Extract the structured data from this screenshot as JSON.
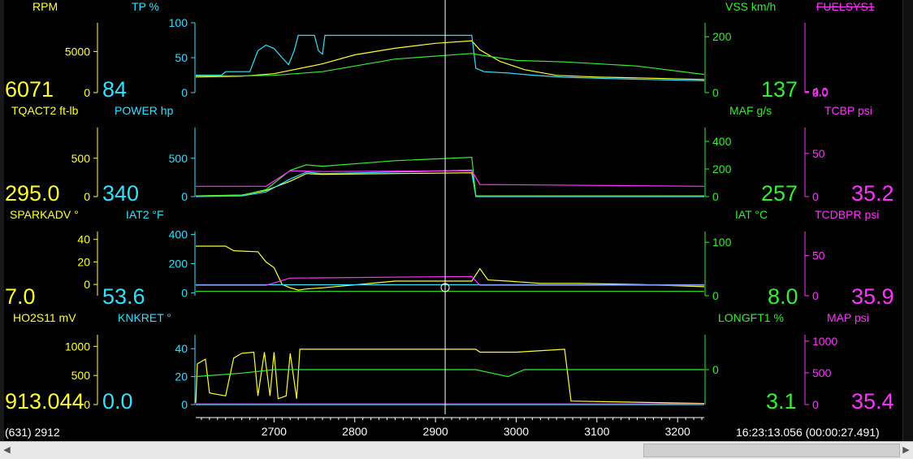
{
  "colors": {
    "yellow": "#ffff33",
    "cyan": "#33e0ff",
    "green": "#33ee33",
    "magenta": "#ff33ff",
    "white": "#ffffff",
    "pink": "#ff6699",
    "blue": "#6688ff"
  },
  "panels": [
    {
      "left_label": "RPM",
      "left_value": "6071",
      "left_ticks": [
        "5000",
        "0"
      ],
      "mid_label": "TP %",
      "mid_value": "84",
      "mid_ticks": [
        "100",
        "50",
        "0"
      ],
      "right_label": "VSS km/h",
      "right_value": "137",
      "right_ticks": [
        "200",
        "0"
      ],
      "far_label": "FUELSYS1",
      "far_ticks": [
        "4.0",
        "2.0",
        "0.0"
      ]
    },
    {
      "left_label": "TQACT2 ft-lb",
      "left_value": "295.0",
      "left_ticks": [
        "500",
        "0"
      ],
      "mid_label": "POWER hp",
      "mid_value": "340",
      "mid_ticks": [
        "500",
        "0"
      ],
      "right_label": "MAF g/s",
      "right_value": "257",
      "right_ticks": [
        "400",
        "200",
        "0"
      ],
      "far_label": "TCBP psi",
      "far_value": "35.2",
      "far_ticks": [
        "50",
        "0"
      ]
    },
    {
      "left_label": "SPARKADV °",
      "left_value": "7.0",
      "left_ticks": [
        "40",
        "20",
        "0"
      ],
      "mid_label": "IAT2 °F",
      "mid_value": "53.6",
      "mid_ticks": [
        "400",
        "200",
        "0"
      ],
      "right_label": "IAT °C",
      "right_value": "8.0",
      "right_ticks": [
        "100",
        "0"
      ],
      "far_label": "TCDBPR psi",
      "far_value": "35.9",
      "far_ticks": [
        "50",
        "0"
      ]
    },
    {
      "left_label": "HO2S11 mV",
      "left_value": "913.044",
      "left_ticks": [
        "1000",
        "500",
        "0"
      ],
      "mid_label": "KNKRET °",
      "mid_value": "0.0",
      "mid_ticks": [
        "40",
        "20",
        "0"
      ],
      "right_label": "LONGFT1 %",
      "right_value": "3.1",
      "right_ticks": [
        "0"
      ],
      "far_label": "MAP psi",
      "far_value": "35.4",
      "far_ticks": [
        "1000",
        "500",
        "0"
      ]
    }
  ],
  "status": {
    "left": "(631) 2912",
    "right": "16:23:13.056 (00:00:27.491)"
  },
  "chart_data": {
    "type": "line",
    "x_ticks": [
      "2700",
      "2800",
      "2900",
      "3000",
      "3100",
      "3200"
    ],
    "xlim": [
      2603,
      3233
    ],
    "cursor_x": 2912,
    "panels": [
      {
        "series": [
          {
            "name": "RPM",
            "color": "yellow",
            "ylim": [
              0,
              8500
            ],
            "points": [
              [
                2603,
                1900
              ],
              [
                2660,
                2000
              ],
              [
                2700,
                2300
              ],
              [
                2760,
                3500
              ],
              [
                2800,
                4600
              ],
              [
                2850,
                5400
              ],
              [
                2900,
                6000
              ],
              [
                2945,
                6300
              ],
              [
                2955,
                5200
              ],
              [
                2980,
                3800
              ],
              [
                3010,
                2800
              ],
              [
                3050,
                2100
              ],
              [
                3100,
                1900
              ],
              [
                3150,
                1800
              ],
              [
                3233,
                1600
              ]
            ]
          },
          {
            "name": "TP %",
            "color": "cyan",
            "ylim": [
              0,
              100
            ],
            "points": [
              [
                2603,
                25
              ],
              [
                2635,
                25
              ],
              [
                2640,
                30
              ],
              [
                2670,
                30
              ],
              [
                2680,
                60
              ],
              [
                2690,
                68
              ],
              [
                2700,
                63
              ],
              [
                2710,
                50
              ],
              [
                2718,
                40
              ],
              [
                2725,
                60
              ],
              [
                2730,
                82
              ],
              [
                2750,
                82
              ],
              [
                2755,
                60
              ],
              [
                2760,
                55
              ],
              [
                2763,
                82
              ],
              [
                2945,
                82
              ],
              [
                2950,
                35
              ],
              [
                2960,
                30
              ],
              [
                2990,
                28
              ],
              [
                3020,
                25
              ],
              [
                3060,
                22
              ],
              [
                3120,
                20
              ],
              [
                3233,
                17
              ]
            ]
          },
          {
            "name": "VSS km/h",
            "color": "green",
            "ylim": [
              0,
              250
            ],
            "points": [
              [
                2603,
                60
              ],
              [
                2660,
                60
              ],
              [
                2700,
                62
              ],
              [
                2760,
                75
              ],
              [
                2850,
                120
              ],
              [
                2945,
                140
              ],
              [
                2955,
                135
              ],
              [
                3000,
                115
              ],
              [
                3060,
                110
              ],
              [
                3150,
                95
              ],
              [
                3233,
                65
              ]
            ]
          }
        ]
      },
      {
        "series": [
          {
            "name": "TQACT2 ft-lb",
            "color": "yellow",
            "ylim": [
              0,
              900
            ],
            "points": [
              [
                2603,
                10
              ],
              [
                2660,
                20
              ],
              [
                2690,
                80
              ],
              [
                2720,
                200
              ],
              [
                2740,
                300
              ],
              [
                2760,
                290
              ],
              [
                2850,
                300
              ],
              [
                2945,
                310
              ],
              [
                2950,
                10
              ],
              [
                3233,
                10
              ]
            ]
          },
          {
            "name": "POWER hp",
            "color": "cyan",
            "ylim": [
              0,
              900
            ],
            "points": [
              [
                2603,
                0
              ],
              [
                2660,
                10
              ],
              [
                2690,
                60
              ],
              [
                2720,
                230
              ],
              [
                2740,
                320
              ],
              [
                2760,
                300
              ],
              [
                2850,
                320
              ],
              [
                2945,
                345
              ],
              [
                2950,
                0
              ],
              [
                3233,
                0
              ]
            ]
          },
          {
            "name": "MAF g/s",
            "color": "green",
            "ylim": [
              0,
              500
            ],
            "points": [
              [
                2603,
                5
              ],
              [
                2660,
                10
              ],
              [
                2690,
                50
              ],
              [
                2720,
                190
              ],
              [
                2740,
                230
              ],
              [
                2760,
                220
              ],
              [
                2850,
                260
              ],
              [
                2945,
                285
              ],
              [
                2950,
                5
              ],
              [
                3233,
                5
              ]
            ]
          },
          {
            "name": "TCBP psi",
            "color": "magenta",
            "ylim": [
              0,
              80
            ],
            "points": [
              [
                2603,
                12
              ],
              [
                2690,
                12
              ],
              [
                2720,
                30
              ],
              [
                2760,
                29
              ],
              [
                2945,
                30
              ],
              [
                2955,
                14
              ],
              [
                3233,
                12
              ]
            ]
          }
        ]
      },
      {
        "series": [
          {
            "name": "SPARKADV °",
            "color": "yellow",
            "ylim": [
              -10,
              47
            ],
            "points": [
              [
                2603,
                34
              ],
              [
                2640,
                34
              ],
              [
                2650,
                30
              ],
              [
                2680,
                29
              ],
              [
                2690,
                20
              ],
              [
                2700,
                15
              ],
              [
                2710,
                0
              ],
              [
                2720,
                -3
              ],
              [
                2730,
                -5
              ],
              [
                2740,
                -4
              ],
              [
                2760,
                -3
              ],
              [
                2850,
                3
              ],
              [
                2945,
                3
              ],
              [
                2955,
                14
              ],
              [
                2965,
                4
              ],
              [
                2990,
                3
              ],
              [
                3030,
                1
              ],
              [
                3080,
                1
              ],
              [
                3150,
                0
              ],
              [
                3233,
                -2
              ]
            ]
          },
          {
            "name": "IAT2 °F",
            "color": "cyan",
            "ylim": [
              -20,
              420
            ],
            "points": [
              [
                2603,
                55
              ],
              [
                3233,
                55
              ]
            ]
          },
          {
            "name": "IAT °C",
            "color": "green",
            "ylim": [
              0,
              120
            ],
            "points": [
              [
                2603,
                8
              ],
              [
                3233,
                8
              ]
            ]
          },
          {
            "name": "TCDBPR psi",
            "color": "magenta",
            "ylim": [
              0,
              80
            ],
            "points": [
              [
                2603,
                13
              ],
              [
                2690,
                13
              ],
              [
                2720,
                22
              ],
              [
                2945,
                24
              ],
              [
                2955,
                13
              ],
              [
                3233,
                13
              ]
            ]
          }
        ]
      },
      {
        "series": [
          {
            "name": "HO2S11 mV",
            "color": "yellow",
            "ylim": [
              0,
              1200
            ],
            "points": [
              [
                2603,
                30
              ],
              [
                2605,
                700
              ],
              [
                2615,
                780
              ],
              [
                2620,
                200
              ],
              [
                2640,
                150
              ],
              [
                2650,
                800
              ],
              [
                2660,
                880
              ],
              [
                2675,
                900
              ],
              [
                2680,
                150
              ],
              [
                2688,
                900
              ],
              [
                2695,
                150
              ],
              [
                2700,
                900
              ],
              [
                2705,
                100
              ],
              [
                2715,
                150
              ],
              [
                2720,
                880
              ],
              [
                2728,
                100
              ],
              [
                2732,
                950
              ],
              [
                2950,
                950
              ],
              [
                2955,
                900
              ],
              [
                3000,
                900
              ],
              [
                3060,
                950
              ],
              [
                3068,
                60
              ],
              [
                3233,
                20
              ]
            ]
          },
          {
            "name": "KNKRET °",
            "color": "cyan",
            "ylim": [
              0,
              50
            ],
            "points": [
              [
                2603,
                0
              ],
              [
                3233,
                0
              ]
            ]
          },
          {
            "name": "LONGFT1 %",
            "color": "green",
            "ylim": [
              -10,
              10
            ],
            "points": [
              [
                2603,
                -2
              ],
              [
                2660,
                -1
              ],
              [
                2700,
                0
              ],
              [
                2740,
                0
              ],
              [
                2950,
                0
              ],
              [
                2970,
                -1
              ],
              [
                2990,
                -2
              ],
              [
                3010,
                0
              ],
              [
                3233,
                0
              ]
            ]
          },
          {
            "name": "MAP psi",
            "color": "magenta",
            "ylim": [
              0,
              1100
            ],
            "points": [
              [
                2603,
                10
              ],
              [
                3233,
                10
              ]
            ]
          }
        ]
      }
    ]
  }
}
